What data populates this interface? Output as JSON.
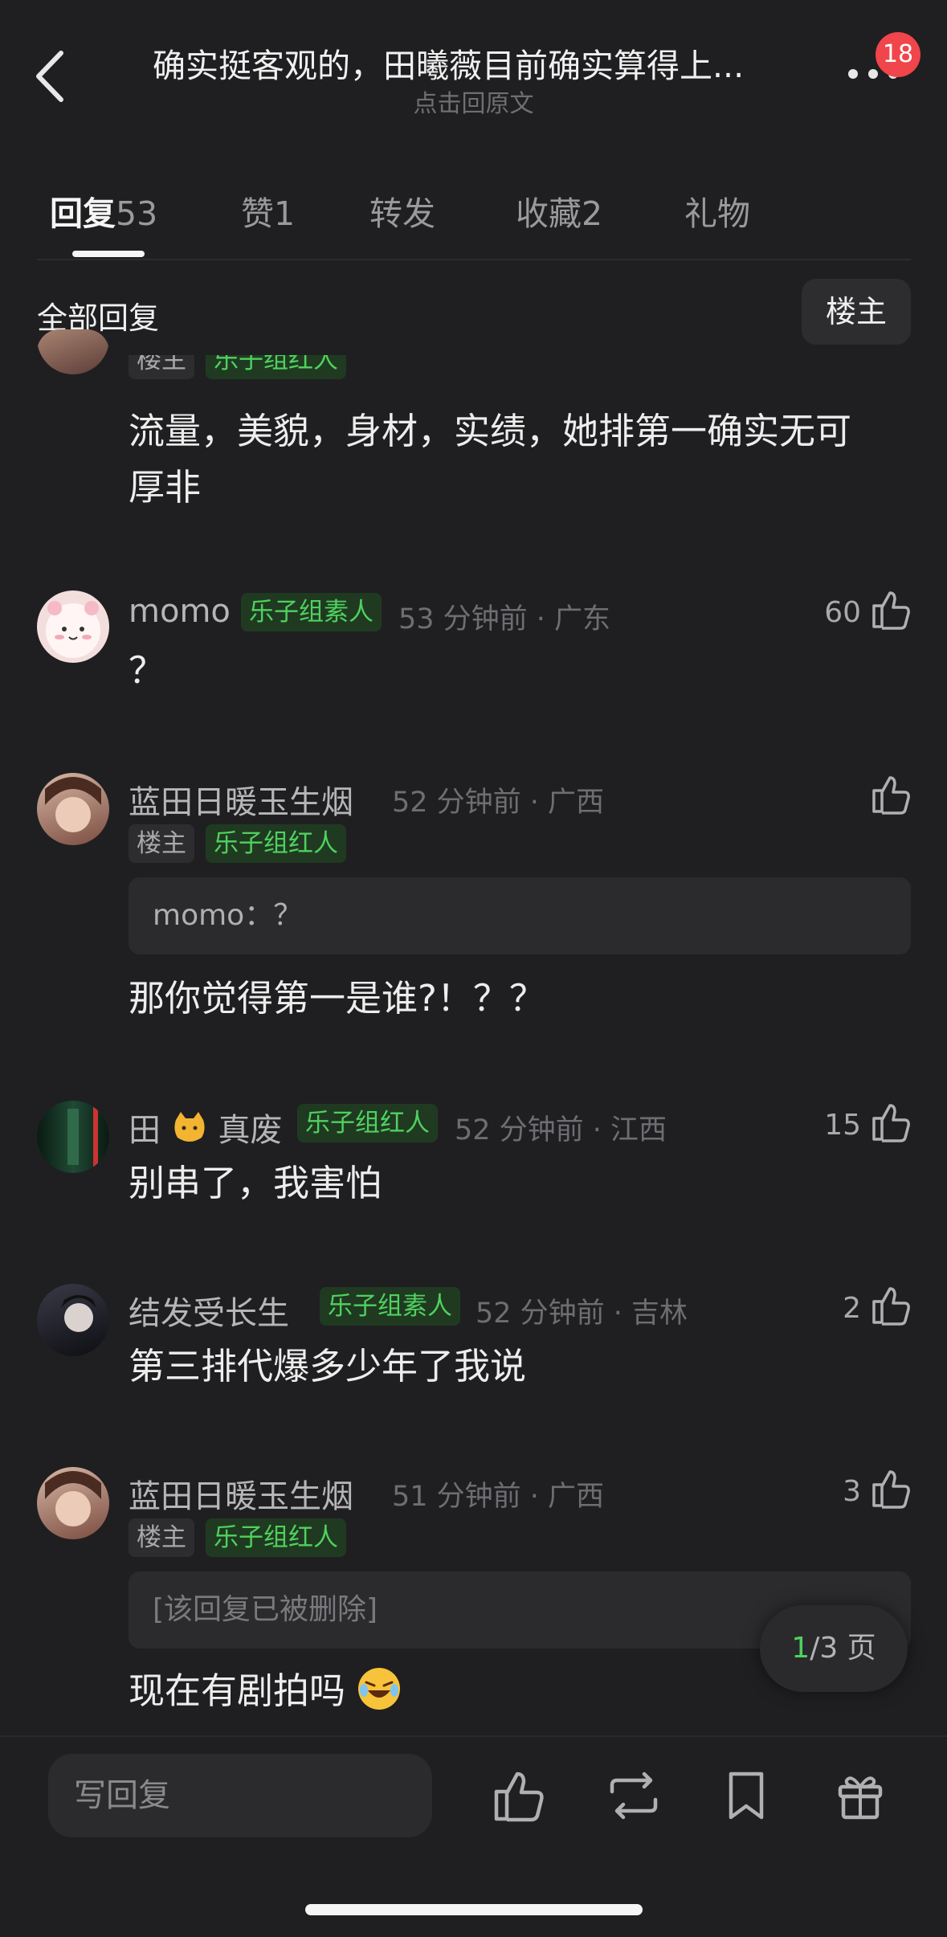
{
  "header": {
    "title": "确实挺客观的，田曦薇目前确实算得上...",
    "subtitle": "点击回原文",
    "badge": "18"
  },
  "tabs": [
    {
      "label": "回复",
      "count": "53"
    },
    {
      "label": "赞",
      "count": "1"
    },
    {
      "label": "转发",
      "count": ""
    },
    {
      "label": "收藏",
      "count": "2"
    },
    {
      "label": "礼物",
      "count": ""
    }
  ],
  "filter": {
    "all_label": "全部回复",
    "owner_button": "楼主"
  },
  "comments": [
    {
      "tags": [
        "楼主",
        "乐子组红人"
      ],
      "text_line1": "流量，美貌，身材，实绩，她排第一确实无可",
      "text_line2": "厚非"
    },
    {
      "name": "momo",
      "tag": "乐子组素人",
      "meta": "53 分钟前 · 广东",
      "likes": "60",
      "text": "？"
    },
    {
      "name": "蓝田日暖玉生烟",
      "meta": "52 分钟前 · 广西",
      "tags": [
        "楼主",
        "乐子组红人"
      ],
      "quote": "momo：？",
      "text": "那你觉得第一是谁?！？？"
    },
    {
      "name_a": "田",
      "name_b": "真废",
      "tag": "乐子组红人",
      "meta": "52 分钟前 · 江西",
      "likes": "15",
      "text": "别串了，我害怕"
    },
    {
      "name": "结发受长生",
      "tag": "乐子组素人",
      "meta": "52 分钟前 · 吉林",
      "likes": "2",
      "text": "第三排代爆多少年了我说"
    },
    {
      "name": "蓝田日暖玉生烟",
      "meta": "51 分钟前 · 广西",
      "likes": "3",
      "tags": [
        "楼主",
        "乐子组红人"
      ],
      "quote": "[该回复已被删除]",
      "text": "现在有剧拍吗"
    }
  ],
  "pager": {
    "current": "1",
    "total": "/3 页"
  },
  "bottom": {
    "placeholder": "写回复"
  },
  "icons": [
    "back-icon",
    "more-icon",
    "thumbs-up-icon",
    "repost-icon",
    "bookmark-icon",
    "gift-icon"
  ]
}
